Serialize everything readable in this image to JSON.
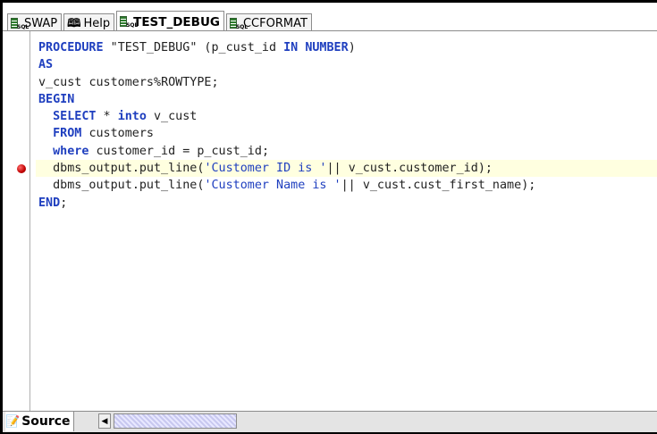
{
  "tabs": [
    {
      "label": "SWAP",
      "icon": "sql-file-icon",
      "active": false
    },
    {
      "label": "Help",
      "icon": "book-icon",
      "active": false
    },
    {
      "label": "TEST_DEBUG",
      "icon": "sql-file-icon",
      "active": true
    },
    {
      "label": "CCFORMAT",
      "icon": "sql-file-icon",
      "active": false
    }
  ],
  "code_lines": [
    "PROCEDURE \"TEST_DEBUG\" (p_cust_id IN NUMBER)",
    "AS",
    "v_cust customers%ROWTYPE;",
    "BEGIN",
    "  SELECT * into v_cust",
    "  FROM customers",
    "  where customer_id = p_cust_id;",
    "  dbms_output.put_line('Customer ID is '|| v_cust.customer_id);",
    "  dbms_output.put_line('Customer Name is '|| v_cust.cust_first_name);",
    "END;"
  ],
  "breakpoint_line": 8,
  "bottom": {
    "source_tab_label": "Source"
  },
  "colors": {
    "keyword": "#1f3fbf",
    "highlight": "#ffffe0",
    "breakpoint": "#c00000"
  }
}
